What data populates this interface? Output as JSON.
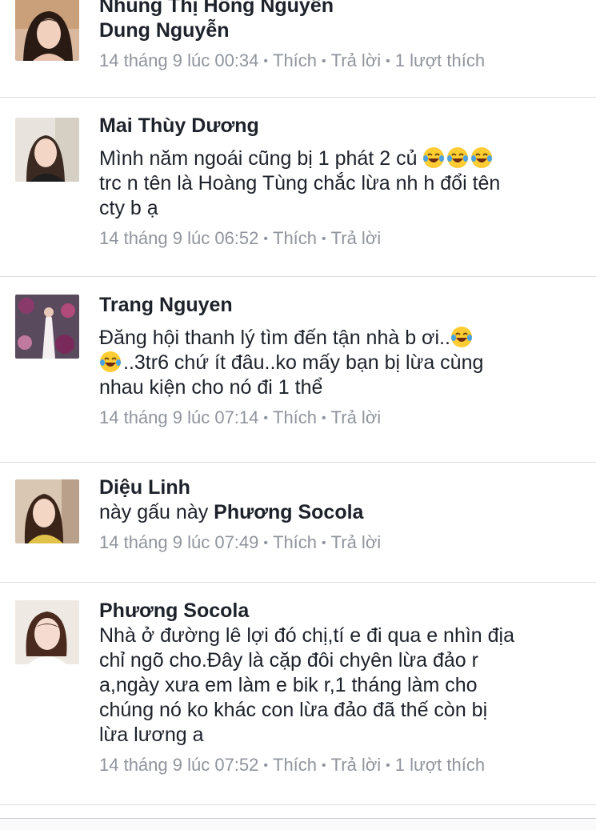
{
  "comments": [
    {
      "author_top": "Nhung Thị Hồng Nguyễn",
      "author": "Dung Nguyễn",
      "timestamp": "14 tháng 9 lúc 00:34",
      "like_label": "Thích",
      "reply_label": "Trả lời",
      "likes_count": "1 lượt thích"
    },
    {
      "author": "Mai Thùy Dương",
      "text_1": "Mình năm ngoái cũng bị 1 phát 2 củ",
      "text_2": "trc n tên là Hoàng Tùng chắc lừa nh h đổi tên",
      "text_3": "cty b ạ",
      "timestamp": "14 tháng 9 lúc 06:52",
      "like_label": "Thích",
      "reply_label": "Trả lời",
      "emoji": "laughing-tears"
    },
    {
      "author": "Trang Nguyen",
      "text_1": "Đăng hội thanh lý tìm đến tận nhà b ơi..",
      "text_2": "..3tr6 chứ ít đâu..ko mấy bạn bị lừa cùng",
      "text_3": "nhau kiện cho nó đi 1 thể",
      "timestamp": "14 tháng 9 lúc 07:14",
      "like_label": "Thích",
      "reply_label": "Trả lời",
      "emoji": "laughing-tears"
    },
    {
      "author": "Diệu Linh",
      "text_1": "này gấu này",
      "mention": "Phương Socola",
      "timestamp": "14 tháng 9 lúc 07:49",
      "like_label": "Thích",
      "reply_label": "Trả lời"
    },
    {
      "author": "Phương Socola",
      "text_1": "Nhà ở đường lê lợi đó chị,tí e đi qua e nhìn địa",
      "text_2": "chỉ ngõ cho.Đây là cặp đôi chyên lừa đảo r",
      "text_3": "a,ngày xưa em làm e bik r,1 tháng làm cho",
      "text_4": "chúng nó ko khác con lừa đảo đã thế còn bị",
      "text_5": "lừa lương a",
      "timestamp": "14 tháng 9 lúc 07:52",
      "like_label": "Thích",
      "reply_label": "Trả lời",
      "likes_count": "1 lượt thích"
    }
  ],
  "colors": {
    "text": "#1d2129",
    "meta": "#90949c",
    "divider": "#dadde1",
    "emoji_face": "#ffcc33",
    "emoji_tears": "#4aa3df"
  }
}
